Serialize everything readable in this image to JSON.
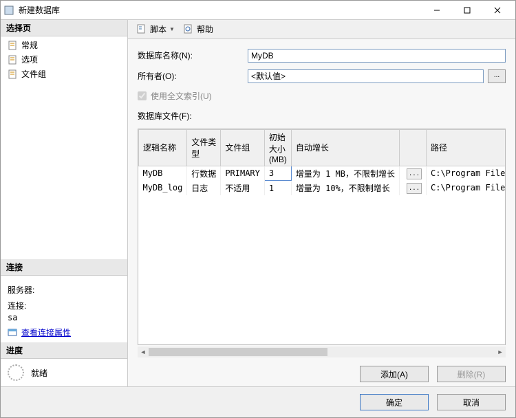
{
  "window": {
    "title": "新建数据库"
  },
  "left": {
    "select_page_header": "选择页",
    "pages": [
      {
        "label": "常规"
      },
      {
        "label": "选项"
      },
      {
        "label": "文件组"
      }
    ],
    "connection_header": "连接",
    "server_label": "服务器:",
    "server_value": "",
    "conn_label": "连接:",
    "conn_value": "sa",
    "view_conn_props": "查看连接属性",
    "progress_header": "进度",
    "ready": "就绪"
  },
  "toolbar": {
    "script": "脚本",
    "help": "帮助"
  },
  "form": {
    "db_name_label": "数据库名称(N):",
    "db_name_value": "MyDB",
    "owner_label": "所有者(O):",
    "owner_value": "<默认值>",
    "fulltext_label": "使用全文索引(U)",
    "files_label": "数据库文件(F):"
  },
  "grid": {
    "headers": {
      "logical_name": "逻辑名称",
      "file_type": "文件类型",
      "filegroup": "文件组",
      "initial_size": "初始大小(MB)",
      "autogrowth": "自动增长",
      "path": "路径"
    },
    "rows": [
      {
        "logical_name": "MyDB",
        "file_type": "行数据",
        "filegroup": "PRIMARY",
        "initial_size": "3",
        "autogrowth": "增量为 1 MB，不限制增长",
        "path": "C:\\Program Files\\Mic"
      },
      {
        "logical_name": "MyDB_log",
        "file_type": "日志",
        "filegroup": "不适用",
        "initial_size": "1",
        "autogrowth": "增量为 10%，不限制增长",
        "path": "C:\\Program Files\\Mic"
      }
    ]
  },
  "buttons": {
    "add": "添加(A)",
    "remove": "删除(R)",
    "ok": "确定",
    "cancel": "取消"
  }
}
